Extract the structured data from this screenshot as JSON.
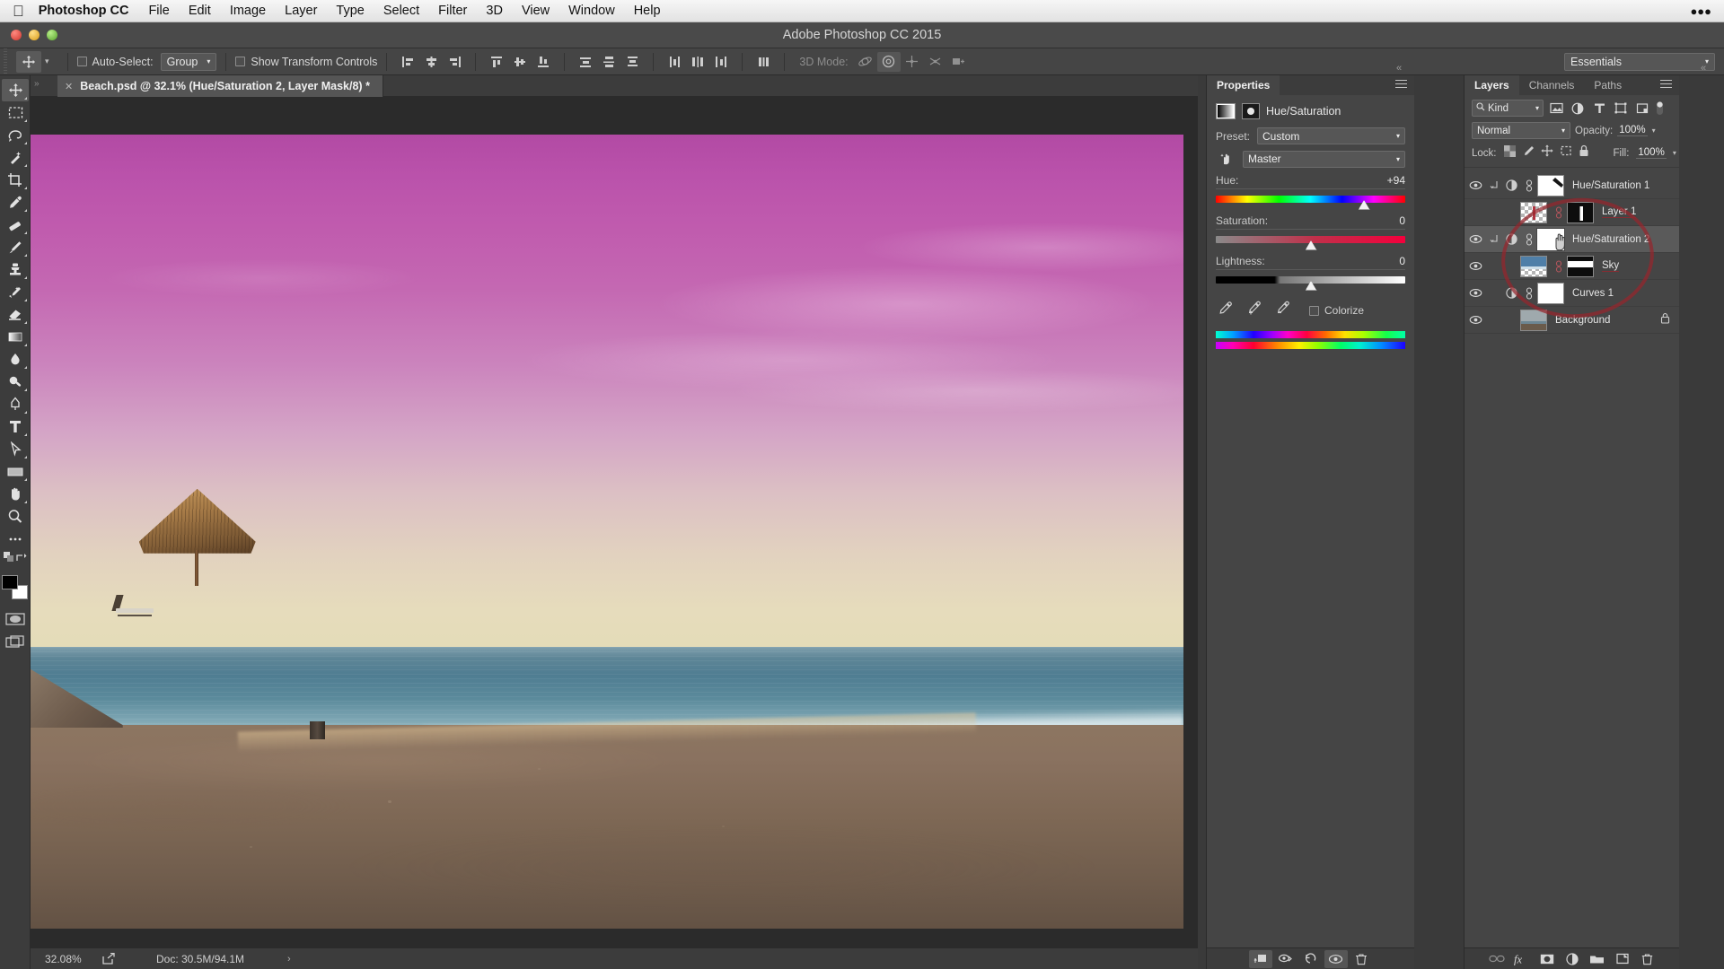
{
  "os_menu": {
    "apple_icon": "apple-logo-icon",
    "app_name": "Photoshop CC",
    "items": [
      "File",
      "Edit",
      "Image",
      "Layer",
      "Type",
      "Select",
      "Filter",
      "3D",
      "View",
      "Window",
      "Help"
    ]
  },
  "window": {
    "title": "Adobe Photoshop CC 2015",
    "traffic_lights": [
      "close",
      "minimize",
      "zoom"
    ]
  },
  "options_bar": {
    "tool_icon": "move-tool-icon",
    "auto_select_label": "Auto-Select:",
    "auto_select_checked": false,
    "auto_select_value": "Group",
    "show_transform_label": "Show Transform Controls",
    "show_transform_checked": false,
    "align_icons": [
      "align-left-edges-icon",
      "align-horizontal-centers-icon",
      "align-right-edges-icon",
      "align-top-edges-icon",
      "align-vertical-centers-icon",
      "align-bottom-edges-icon"
    ],
    "distribute_icons": [
      "distribute-top-edges-icon",
      "distribute-vertical-centers-icon",
      "distribute-bottom-edges-icon",
      "distribute-left-edges-icon",
      "distribute-horizontal-centers-icon",
      "distribute-right-edges-icon"
    ],
    "auto_align_icon": "auto-align-layers-icon",
    "mode_3d_label": "3D Mode:",
    "mode_3d_icons": [
      "rotate-3d-icon",
      "roll-3d-icon",
      "pan-3d-icon",
      "slide-3d-icon",
      "scale-3d-icon"
    ],
    "workspace": "Essentials"
  },
  "document": {
    "tab_title": "Beach.psd @ 32.1% (Hue/Saturation 2, Layer Mask/8) *",
    "close_icon": "close-icon"
  },
  "toolbar": {
    "tools": [
      {
        "name": "move-tool",
        "active": true,
        "has_flyout": true
      },
      {
        "name": "rectangular-marquee-tool",
        "active": false,
        "has_flyout": true
      },
      {
        "name": "lasso-tool",
        "active": false,
        "has_flyout": true
      },
      {
        "name": "quick-selection-tool",
        "active": false,
        "has_flyout": true
      },
      {
        "name": "crop-tool",
        "active": false,
        "has_flyout": true
      },
      {
        "name": "eyedropper-tool",
        "active": false,
        "has_flyout": true
      },
      {
        "name": "spot-healing-brush-tool",
        "active": false,
        "has_flyout": true
      },
      {
        "name": "brush-tool",
        "active": false,
        "has_flyout": true
      },
      {
        "name": "clone-stamp-tool",
        "active": false,
        "has_flyout": true
      },
      {
        "name": "history-brush-tool",
        "active": false,
        "has_flyout": true
      },
      {
        "name": "eraser-tool",
        "active": false,
        "has_flyout": true
      },
      {
        "name": "gradient-tool",
        "active": false,
        "has_flyout": true
      },
      {
        "name": "blur-tool",
        "active": false,
        "has_flyout": true
      },
      {
        "name": "dodge-tool",
        "active": false,
        "has_flyout": true
      },
      {
        "name": "pen-tool",
        "active": false,
        "has_flyout": true
      },
      {
        "name": "type-tool",
        "active": false,
        "has_flyout": true
      },
      {
        "name": "path-selection-tool",
        "active": false,
        "has_flyout": true
      },
      {
        "name": "rectangle-tool",
        "active": false,
        "has_flyout": true
      },
      {
        "name": "hand-tool",
        "active": false,
        "has_flyout": true
      },
      {
        "name": "zoom-tool",
        "active": false,
        "has_flyout": false
      },
      {
        "name": "edit-toolbar-ellipsis",
        "active": false,
        "has_flyout": false
      }
    ],
    "foreground_color": "#000000",
    "background_color": "#ffffff",
    "quick_mask_icon": "quick-mask-icon",
    "screen_mode_icon": "screen-mode-icon"
  },
  "status_bar": {
    "zoom": "32.08%",
    "share_icon": "share-icon",
    "doc_info": "Doc: 30.5M/94.1M",
    "expand_arrow": "›"
  },
  "properties": {
    "tabs": [
      {
        "label": "Properties",
        "active": true
      }
    ],
    "menu_icon": "panel-menu-icon",
    "adjustment_title": "Hue/Saturation",
    "layer_thumb_icon": "adjustment-thumbnail-icon",
    "mask_thumb_icon": "layer-mask-thumbnail-icon",
    "preset_label": "Preset:",
    "preset_value": "Custom",
    "targeted_adjust_icon": "on-image-adjustment-tool-icon",
    "channel_value": "Master",
    "sliders": [
      {
        "label": "Hue:",
        "value": "+94",
        "pos_pct": 78.0,
        "bar": "hue"
      },
      {
        "label": "Saturation:",
        "value": "0",
        "pos_pct": 50.0,
        "bar": "sat"
      },
      {
        "label": "Lightness:",
        "value": "0",
        "pos_pct": 50.0,
        "bar": "light"
      }
    ],
    "eyedroppers": [
      "eyedropper-icon",
      "eyedropper-add-icon",
      "eyedropper-subtract-icon"
    ],
    "colorize_label": "Colorize",
    "colorize_checked": false,
    "spectrum_bars": [
      "input-spectrum-bar",
      "output-spectrum-bar"
    ],
    "footer_icons": [
      {
        "name": "clip-to-layer-icon",
        "active": true
      },
      {
        "name": "view-previous-state-icon",
        "active": false
      },
      {
        "name": "reset-adjustment-icon",
        "active": false
      },
      {
        "name": "toggle-layer-visibility-icon",
        "active": true
      },
      {
        "name": "delete-adjustment-layer-icon",
        "active": false
      }
    ]
  },
  "layers": {
    "tabs": [
      {
        "label": "Layers",
        "active": true
      },
      {
        "label": "Channels",
        "active": false
      },
      {
        "label": "Paths",
        "active": false
      }
    ],
    "menu_icon": "panel-menu-icon",
    "filter_label": "Kind",
    "filter_search_icon": "search-icon",
    "filter_icons": [
      "filter-pixel-layers-icon",
      "filter-adjustment-layers-icon",
      "filter-type-layers-icon",
      "filter-shape-layers-icon",
      "filter-smart-objects-icon"
    ],
    "filter_toggle_icon": "filter-enable-toggle-icon",
    "blend_mode": "Normal",
    "opacity_label": "Opacity:",
    "opacity_value": "100%",
    "lock_label": "Lock:",
    "lock_icons": [
      "lock-transparent-pixels-icon",
      "lock-image-pixels-icon",
      "lock-position-icon",
      "lock-artboard-nesting-icon",
      "lock-all-icon"
    ],
    "fill_label": "Fill:",
    "fill_value": "100%",
    "rows": [
      {
        "name": "Hue/Saturation 1",
        "visible": true,
        "selected": false,
        "clipped": true,
        "has_adjustment_icon": true,
        "linked": true,
        "thumb_type": "mask-gradient-diagonal",
        "locked": false,
        "annotated": false
      },
      {
        "name": "Layer 1",
        "visible": false,
        "selected": false,
        "clipped": false,
        "has_adjustment_icon": false,
        "linked": true,
        "thumb_type": "pixel-checker-red",
        "mask_type": "mask-black-stripe",
        "locked": false,
        "annotated": true
      },
      {
        "name": "Hue/Saturation 2",
        "visible": true,
        "selected": true,
        "clipped": true,
        "has_adjustment_icon": true,
        "linked": true,
        "thumb_type": "mask-white-selected",
        "locked": false,
        "annotated": false
      },
      {
        "name": "Sky",
        "visible": true,
        "selected": false,
        "clipped": false,
        "has_adjustment_icon": false,
        "linked": true,
        "thumb_type": "pixel-sky",
        "mask_type": "mask-white-black-band",
        "locked": false,
        "annotated": true
      },
      {
        "name": "Curves 1",
        "visible": true,
        "selected": false,
        "clipped": false,
        "has_adjustment_icon": true,
        "linked": true,
        "thumb_type": "mask-white",
        "locked": false,
        "annotated": false
      },
      {
        "name": "Background",
        "visible": true,
        "selected": false,
        "clipped": false,
        "has_adjustment_icon": false,
        "linked": false,
        "thumb_type": "pixel-beach",
        "locked": true,
        "annotated": false
      }
    ],
    "footer_icons": [
      "link-layers-icon",
      "add-layer-style-fx-icon",
      "add-layer-mask-icon",
      "new-adjustment-layer-icon",
      "new-group-icon",
      "new-layer-icon",
      "delete-layer-icon"
    ]
  },
  "icon_rail": {
    "buttons": [
      "history-icon",
      "actions-play-icon",
      "character-panel-icon",
      "paragraph-panel-icon",
      "3d-panel-icon"
    ]
  },
  "annotation": {
    "shape": "red-ellipse-highlight",
    "color": "#96262d"
  },
  "canvas": {
    "scene": "beach-sunset-with-magenta-sky",
    "colors": {
      "sky_top": "#b24aa4",
      "sky_horizon": "#e4dcb8",
      "ocean": "#4f7d92",
      "sand": "#7e6855"
    }
  }
}
